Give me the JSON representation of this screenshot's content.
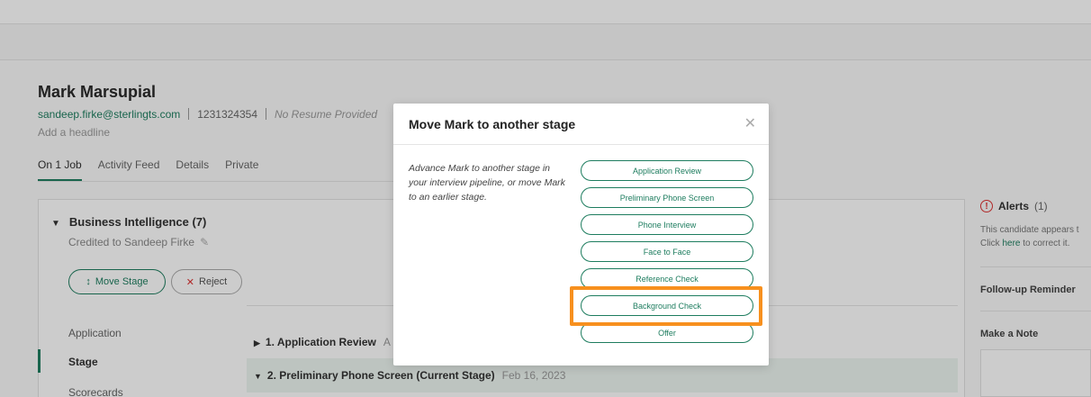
{
  "candidate": {
    "name": "Mark Marsupial",
    "email": "sandeep.firke@sterlingts.com",
    "phone": "1231324354",
    "resume_status": "No Resume Provided",
    "headline_placeholder": "Add a headline"
  },
  "tabs": [
    "On 1 Job",
    "Activity Feed",
    "Details",
    "Private"
  ],
  "job": {
    "title": "Business Intelligence (7)",
    "credited": "Credited to Sandeep Firke",
    "move_stage_label": "Move Stage",
    "reject_label": "Reject"
  },
  "side_nav": [
    "Application",
    "Stage",
    "Scorecards"
  ],
  "stages": [
    {
      "label": "1. Application Review",
      "date": "A"
    },
    {
      "label": "2. Preliminary Phone Screen (Current Stage)",
      "date": "Feb 16, 2023"
    }
  ],
  "right_panel": {
    "alerts_title": "Alerts",
    "alerts_count": "(1)",
    "alert_line1": "This candidate appears t",
    "alert_line2_pre": "Click ",
    "alert_link": "here",
    "alert_line2_post": " to correct it.",
    "followup_title": "Follow-up Reminder",
    "note_title": "Make a Note"
  },
  "modal": {
    "title": "Move Mark to another stage",
    "description": "Advance Mark to another stage in your interview pipeline, or move Mark to an earlier stage.",
    "stage_options": [
      "Application Review",
      "Preliminary Phone Screen",
      "Phone Interview",
      "Face to Face",
      "Reference Check",
      "Background Check",
      "Offer"
    ]
  },
  "colors": {
    "accent": "#1e7d5f",
    "highlight": "#f7901e",
    "alert": "#dd3333"
  }
}
